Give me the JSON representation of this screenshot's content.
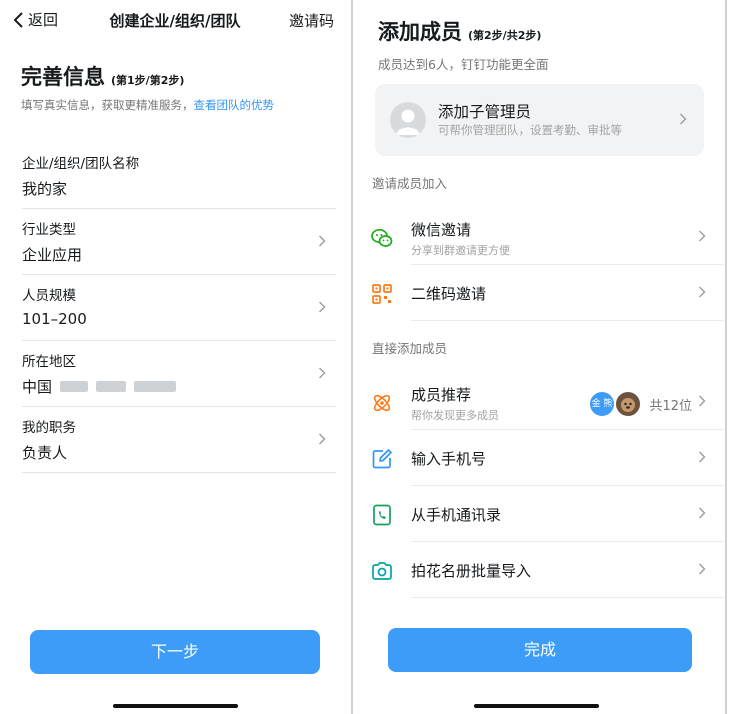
{
  "left": {
    "nav": {
      "back_label": "返回",
      "title": "创建企业/组织/团队",
      "right_label": "邀请码"
    },
    "heading": {
      "title": "完善信息",
      "step": "(第1步/第2步)",
      "hint": "填写真实信息，获取更精准服务，",
      "hint_link": "查看团队的优势"
    },
    "fields": [
      {
        "label": "企业/组织/团队名称",
        "value": "我的家"
      },
      {
        "label": "行业类型",
        "value": "企业应用"
      },
      {
        "label": "人员规模",
        "value": "101–200"
      },
      {
        "label": "所在地区",
        "value": "中国"
      },
      {
        "label": "我的职务",
        "value": "负责人"
      }
    ],
    "next_button": "下一步"
  },
  "right": {
    "heading": {
      "title": "添加成员",
      "step": "(第2步/共2步)",
      "hint": "成员达到6人，钉钉功能更全面"
    },
    "admin_card": {
      "title": "添加子管理员",
      "subtitle": "可帮你管理团队，设置考勤、审批等"
    },
    "section_invite": "邀请成员加入",
    "invite_rows": [
      {
        "title": "微信邀请",
        "subtitle": "分享到群邀请更方便",
        "icon": "wechat-icon"
      },
      {
        "title": "二维码邀请",
        "icon": "qrcode-icon"
      }
    ],
    "section_direct": "直接添加成员",
    "recommend": {
      "title": "成员推荐",
      "subtitle": "帮你发现更多成员",
      "avatar_text": "金 熊",
      "count": "共12位"
    },
    "direct_rows": [
      {
        "title": "输入手机号",
        "icon": "edit-phone-icon"
      },
      {
        "title": "从手机通讯录",
        "icon": "phone-contacts-icon"
      },
      {
        "title": "拍花名册批量导入",
        "icon": "camera-icon"
      }
    ],
    "done_button": "完成"
  },
  "colors": {
    "accent": "#3d9cf8",
    "link": "#3296fa",
    "wechat": "#1aad19",
    "orange": "#ff7a1a",
    "blue_icon": "#3296fa",
    "green_icon": "#16a05d",
    "teal_icon": "#00a6a0"
  }
}
